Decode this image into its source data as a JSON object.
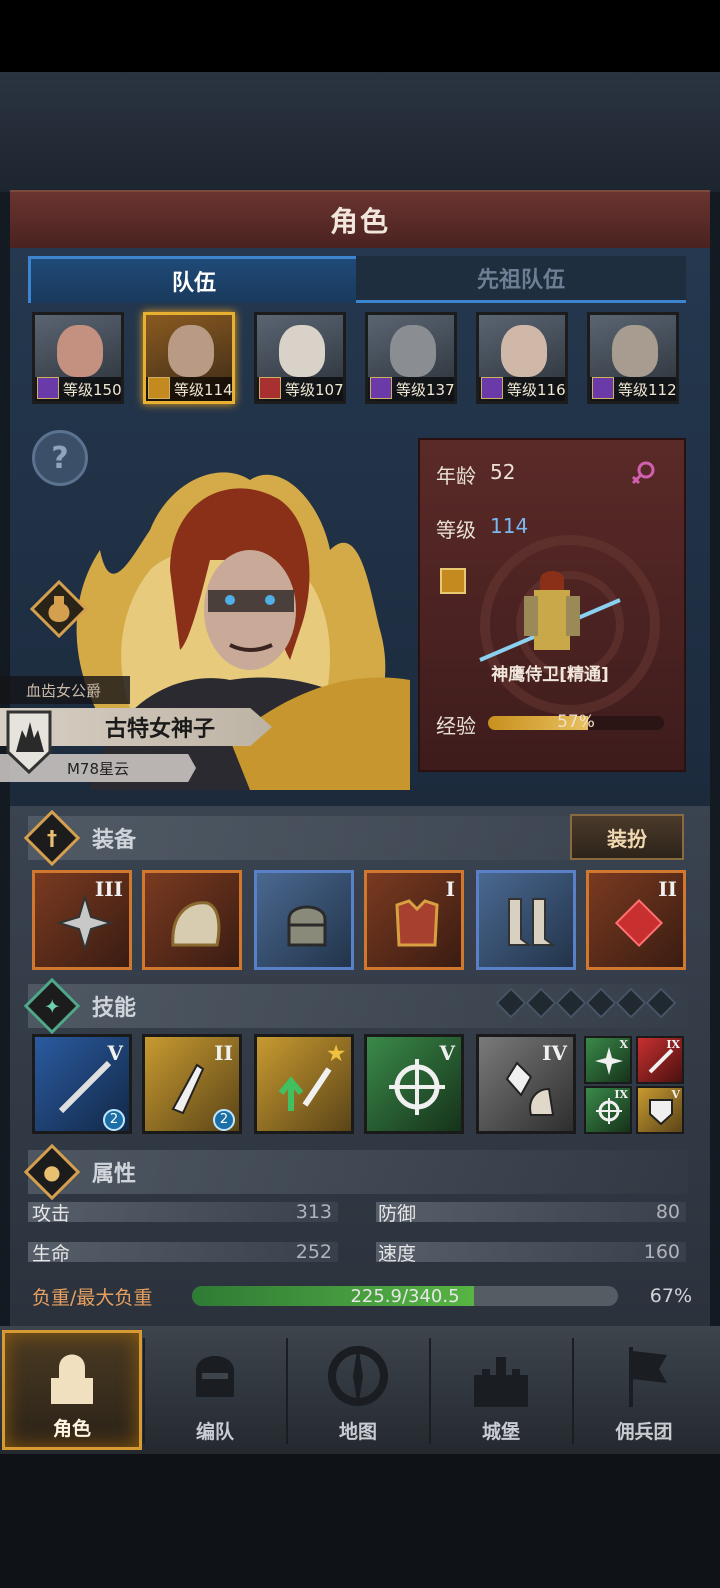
{
  "header": {
    "title": "角色"
  },
  "tabs": [
    {
      "label": "队伍",
      "active": true
    },
    {
      "label": "先祖队伍",
      "active": false
    }
  ],
  "team": [
    {
      "level_text": "等级150",
      "class_icon": "staff-icon"
    },
    {
      "level_text": "等级114",
      "class_icon": "eagle-icon",
      "selected": true
    },
    {
      "level_text": "等级107",
      "class_icon": "horse-icon"
    },
    {
      "level_text": "等级137",
      "class_icon": "staff-icon"
    },
    {
      "level_text": "等级116",
      "class_icon": "staff-icon"
    },
    {
      "level_text": "等级112",
      "class_icon": "staff-icon"
    }
  ],
  "hero": {
    "title": "血齿女公爵",
    "name": "古特女神子",
    "origin": "M78星云"
  },
  "info": {
    "age_label": "年龄",
    "age": "52",
    "level_label": "等级",
    "level": "114",
    "class_name": "神鹰侍卫[精通]",
    "exp_label": "经验",
    "exp_text": "57%",
    "exp_fraction": 0.57
  },
  "equipment": {
    "label": "装备",
    "dress_button": "装扮",
    "items": [
      {
        "rank": "III",
        "icon": "shuriken-icon"
      },
      {
        "rank": "",
        "icon": "shoulder-armor-icon"
      },
      {
        "rank": "",
        "icon": "helmet-icon"
      },
      {
        "rank": "I",
        "icon": "chest-armor-icon"
      },
      {
        "rank": "",
        "icon": "boots-icon"
      },
      {
        "rank": "II",
        "icon": "knot-charm-icon"
      }
    ]
  },
  "skills": {
    "label": "技能",
    "items": [
      {
        "rank": "V",
        "badge": "2"
      },
      {
        "rank": "II",
        "badge": "2"
      },
      {
        "rank": "",
        "badge": ""
      },
      {
        "rank": "V",
        "badge": ""
      },
      {
        "rank": "IV",
        "badge": ""
      }
    ],
    "mini": [
      {
        "rank": "X"
      },
      {
        "rank": "IX"
      },
      {
        "rank": "IX"
      },
      {
        "rank": "V"
      }
    ]
  },
  "attributes": {
    "label": "属性",
    "attack_label": "攻击",
    "attack": "313",
    "defense_label": "防御",
    "defense": "80",
    "hp_label": "生命",
    "hp": "252",
    "speed_label": "速度",
    "speed": "160",
    "load_label": "负重/最大负重",
    "load_text": "225.9/340.5",
    "load_percent": "67%",
    "load_fraction": 0.663
  },
  "nav": [
    {
      "label": "角色",
      "active": true
    },
    {
      "label": "编队"
    },
    {
      "label": "地图"
    },
    {
      "label": "城堡"
    },
    {
      "label": "佣兵团"
    }
  ],
  "colors": {
    "accent_blue": "#3d84d0",
    "gold": "#e8b030",
    "title_red": "#5a2a28",
    "load_green": "#58b444"
  }
}
